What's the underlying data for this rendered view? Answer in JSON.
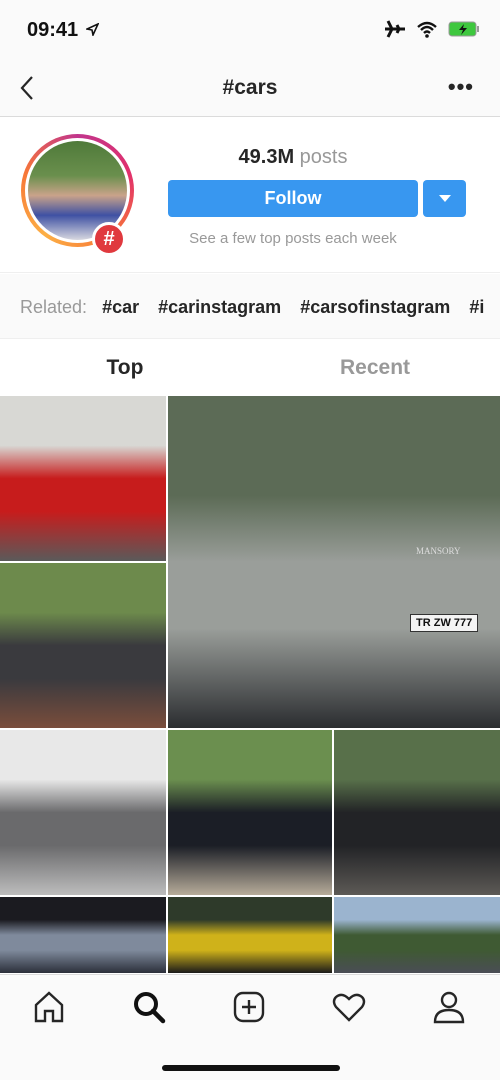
{
  "status": {
    "time": "09:41"
  },
  "nav": {
    "title": "#cars"
  },
  "header": {
    "post_count": "49.3M",
    "posts_label": "posts",
    "follow_label": "Follow",
    "subtitle": "See a few top posts each week"
  },
  "related": {
    "label": "Related:",
    "tags": [
      "#car",
      "#carinstagram",
      "#carsofinstagram",
      "#i"
    ]
  },
  "tabs": [
    {
      "label": "Top",
      "active": true
    },
    {
      "label": "Recent",
      "active": false
    }
  ],
  "grid": [
    {
      "desc": "red lamborghini",
      "colors": [
        "#d8d8d4",
        "#c71c1c",
        "#5a5a5a"
      ]
    },
    {
      "desc": "mansory g-wagon",
      "colors": [
        "#5c6b56",
        "#9a9e9a",
        "#2b2d30"
      ],
      "plate": "TR ZW 777",
      "badge": "MANSORY"
    },
    {
      "desc": "black urus",
      "colors": [
        "#6d8a4c",
        "#3a3a3e",
        "#7a4d3c"
      ]
    },
    {
      "desc": "grey mustang",
      "colors": [
        "#e8e8e8",
        "#6a6a6c",
        "#bdbdbd"
      ]
    },
    {
      "desc": "black cars",
      "colors": [
        "#6b8f4f",
        "#1b1e26",
        "#b7ac9a"
      ]
    },
    {
      "desc": "black bmw",
      "colors": [
        "#58704a",
        "#222326",
        "#5d5a56"
      ]
    },
    {
      "desc": "interior",
      "colors": [
        "#1b1b20",
        "#7f8a9c",
        "#2b2f3a"
      ]
    },
    {
      "desc": "yellow car",
      "colors": [
        "#2e3a2a",
        "#cfb21a",
        "#1a1a1a"
      ]
    },
    {
      "desc": "grey sedan",
      "colors": [
        "#9bb4cf",
        "#3f5a33",
        "#4a4d55"
      ]
    }
  ],
  "bottom_nav": [
    "home-icon",
    "search-icon",
    "new-post-icon",
    "heart-icon",
    "profile-icon"
  ],
  "colors": {
    "accent": "#3897f0",
    "badge": "#e0393e"
  }
}
